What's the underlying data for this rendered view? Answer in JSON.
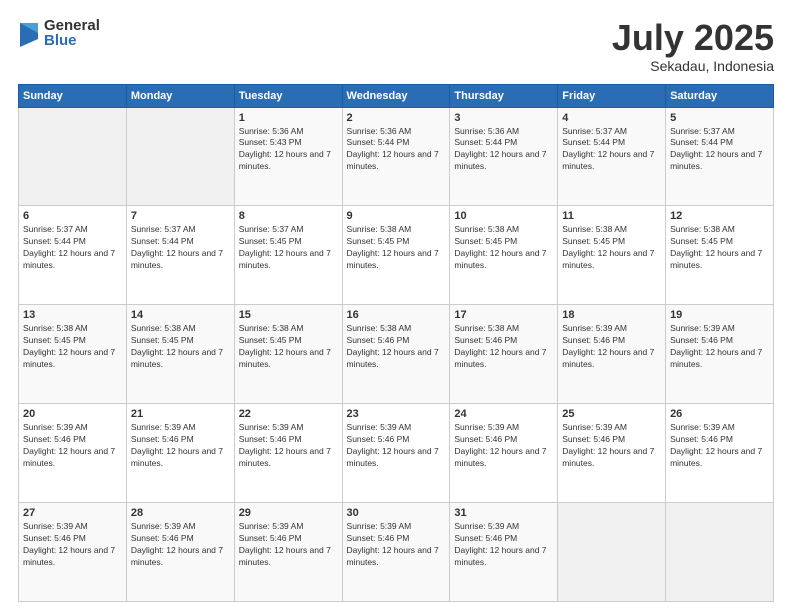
{
  "logo": {
    "general": "General",
    "blue": "Blue"
  },
  "header": {
    "month": "July 2025",
    "location": "Sekadau, Indonesia"
  },
  "weekdays": [
    "Sunday",
    "Monday",
    "Tuesday",
    "Wednesday",
    "Thursday",
    "Friday",
    "Saturday"
  ],
  "weeks": [
    [
      {
        "day": "",
        "sunrise": "",
        "sunset": "",
        "daylight": ""
      },
      {
        "day": "",
        "sunrise": "",
        "sunset": "",
        "daylight": ""
      },
      {
        "day": "1",
        "sunrise": "Sunrise: 5:36 AM",
        "sunset": "Sunset: 5:43 PM",
        "daylight": "Daylight: 12 hours and 7 minutes."
      },
      {
        "day": "2",
        "sunrise": "Sunrise: 5:36 AM",
        "sunset": "Sunset: 5:44 PM",
        "daylight": "Daylight: 12 hours and 7 minutes."
      },
      {
        "day": "3",
        "sunrise": "Sunrise: 5:36 AM",
        "sunset": "Sunset: 5:44 PM",
        "daylight": "Daylight: 12 hours and 7 minutes."
      },
      {
        "day": "4",
        "sunrise": "Sunrise: 5:37 AM",
        "sunset": "Sunset: 5:44 PM",
        "daylight": "Daylight: 12 hours and 7 minutes."
      },
      {
        "day": "5",
        "sunrise": "Sunrise: 5:37 AM",
        "sunset": "Sunset: 5:44 PM",
        "daylight": "Daylight: 12 hours and 7 minutes."
      }
    ],
    [
      {
        "day": "6",
        "sunrise": "Sunrise: 5:37 AM",
        "sunset": "Sunset: 5:44 PM",
        "daylight": "Daylight: 12 hours and 7 minutes."
      },
      {
        "day": "7",
        "sunrise": "Sunrise: 5:37 AM",
        "sunset": "Sunset: 5:44 PM",
        "daylight": "Daylight: 12 hours and 7 minutes."
      },
      {
        "day": "8",
        "sunrise": "Sunrise: 5:37 AM",
        "sunset": "Sunset: 5:45 PM",
        "daylight": "Daylight: 12 hours and 7 minutes."
      },
      {
        "day": "9",
        "sunrise": "Sunrise: 5:38 AM",
        "sunset": "Sunset: 5:45 PM",
        "daylight": "Daylight: 12 hours and 7 minutes."
      },
      {
        "day": "10",
        "sunrise": "Sunrise: 5:38 AM",
        "sunset": "Sunset: 5:45 PM",
        "daylight": "Daylight: 12 hours and 7 minutes."
      },
      {
        "day": "11",
        "sunrise": "Sunrise: 5:38 AM",
        "sunset": "Sunset: 5:45 PM",
        "daylight": "Daylight: 12 hours and 7 minutes."
      },
      {
        "day": "12",
        "sunrise": "Sunrise: 5:38 AM",
        "sunset": "Sunset: 5:45 PM",
        "daylight": "Daylight: 12 hours and 7 minutes."
      }
    ],
    [
      {
        "day": "13",
        "sunrise": "Sunrise: 5:38 AM",
        "sunset": "Sunset: 5:45 PM",
        "daylight": "Daylight: 12 hours and 7 minutes."
      },
      {
        "day": "14",
        "sunrise": "Sunrise: 5:38 AM",
        "sunset": "Sunset: 5:45 PM",
        "daylight": "Daylight: 12 hours and 7 minutes."
      },
      {
        "day": "15",
        "sunrise": "Sunrise: 5:38 AM",
        "sunset": "Sunset: 5:45 PM",
        "daylight": "Daylight: 12 hours and 7 minutes."
      },
      {
        "day": "16",
        "sunrise": "Sunrise: 5:38 AM",
        "sunset": "Sunset: 5:46 PM",
        "daylight": "Daylight: 12 hours and 7 minutes."
      },
      {
        "day": "17",
        "sunrise": "Sunrise: 5:38 AM",
        "sunset": "Sunset: 5:46 PM",
        "daylight": "Daylight: 12 hours and 7 minutes."
      },
      {
        "day": "18",
        "sunrise": "Sunrise: 5:39 AM",
        "sunset": "Sunset: 5:46 PM",
        "daylight": "Daylight: 12 hours and 7 minutes."
      },
      {
        "day": "19",
        "sunrise": "Sunrise: 5:39 AM",
        "sunset": "Sunset: 5:46 PM",
        "daylight": "Daylight: 12 hours and 7 minutes."
      }
    ],
    [
      {
        "day": "20",
        "sunrise": "Sunrise: 5:39 AM",
        "sunset": "Sunset: 5:46 PM",
        "daylight": "Daylight: 12 hours and 7 minutes."
      },
      {
        "day": "21",
        "sunrise": "Sunrise: 5:39 AM",
        "sunset": "Sunset: 5:46 PM",
        "daylight": "Daylight: 12 hours and 7 minutes."
      },
      {
        "day": "22",
        "sunrise": "Sunrise: 5:39 AM",
        "sunset": "Sunset: 5:46 PM",
        "daylight": "Daylight: 12 hours and 7 minutes."
      },
      {
        "day": "23",
        "sunrise": "Sunrise: 5:39 AM",
        "sunset": "Sunset: 5:46 PM",
        "daylight": "Daylight: 12 hours and 7 minutes."
      },
      {
        "day": "24",
        "sunrise": "Sunrise: 5:39 AM",
        "sunset": "Sunset: 5:46 PM",
        "daylight": "Daylight: 12 hours and 7 minutes."
      },
      {
        "day": "25",
        "sunrise": "Sunrise: 5:39 AM",
        "sunset": "Sunset: 5:46 PM",
        "daylight": "Daylight: 12 hours and 7 minutes."
      },
      {
        "day": "26",
        "sunrise": "Sunrise: 5:39 AM",
        "sunset": "Sunset: 5:46 PM",
        "daylight": "Daylight: 12 hours and 7 minutes."
      }
    ],
    [
      {
        "day": "27",
        "sunrise": "Sunrise: 5:39 AM",
        "sunset": "Sunset: 5:46 PM",
        "daylight": "Daylight: 12 hours and 7 minutes."
      },
      {
        "day": "28",
        "sunrise": "Sunrise: 5:39 AM",
        "sunset": "Sunset: 5:46 PM",
        "daylight": "Daylight: 12 hours and 7 minutes."
      },
      {
        "day": "29",
        "sunrise": "Sunrise: 5:39 AM",
        "sunset": "Sunset: 5:46 PM",
        "daylight": "Daylight: 12 hours and 7 minutes."
      },
      {
        "day": "30",
        "sunrise": "Sunrise: 5:39 AM",
        "sunset": "Sunset: 5:46 PM",
        "daylight": "Daylight: 12 hours and 7 minutes."
      },
      {
        "day": "31",
        "sunrise": "Sunrise: 5:39 AM",
        "sunset": "Sunset: 5:46 PM",
        "daylight": "Daylight: 12 hours and 7 minutes."
      },
      {
        "day": "",
        "sunrise": "",
        "sunset": "",
        "daylight": ""
      },
      {
        "day": "",
        "sunrise": "",
        "sunset": "",
        "daylight": ""
      }
    ]
  ]
}
